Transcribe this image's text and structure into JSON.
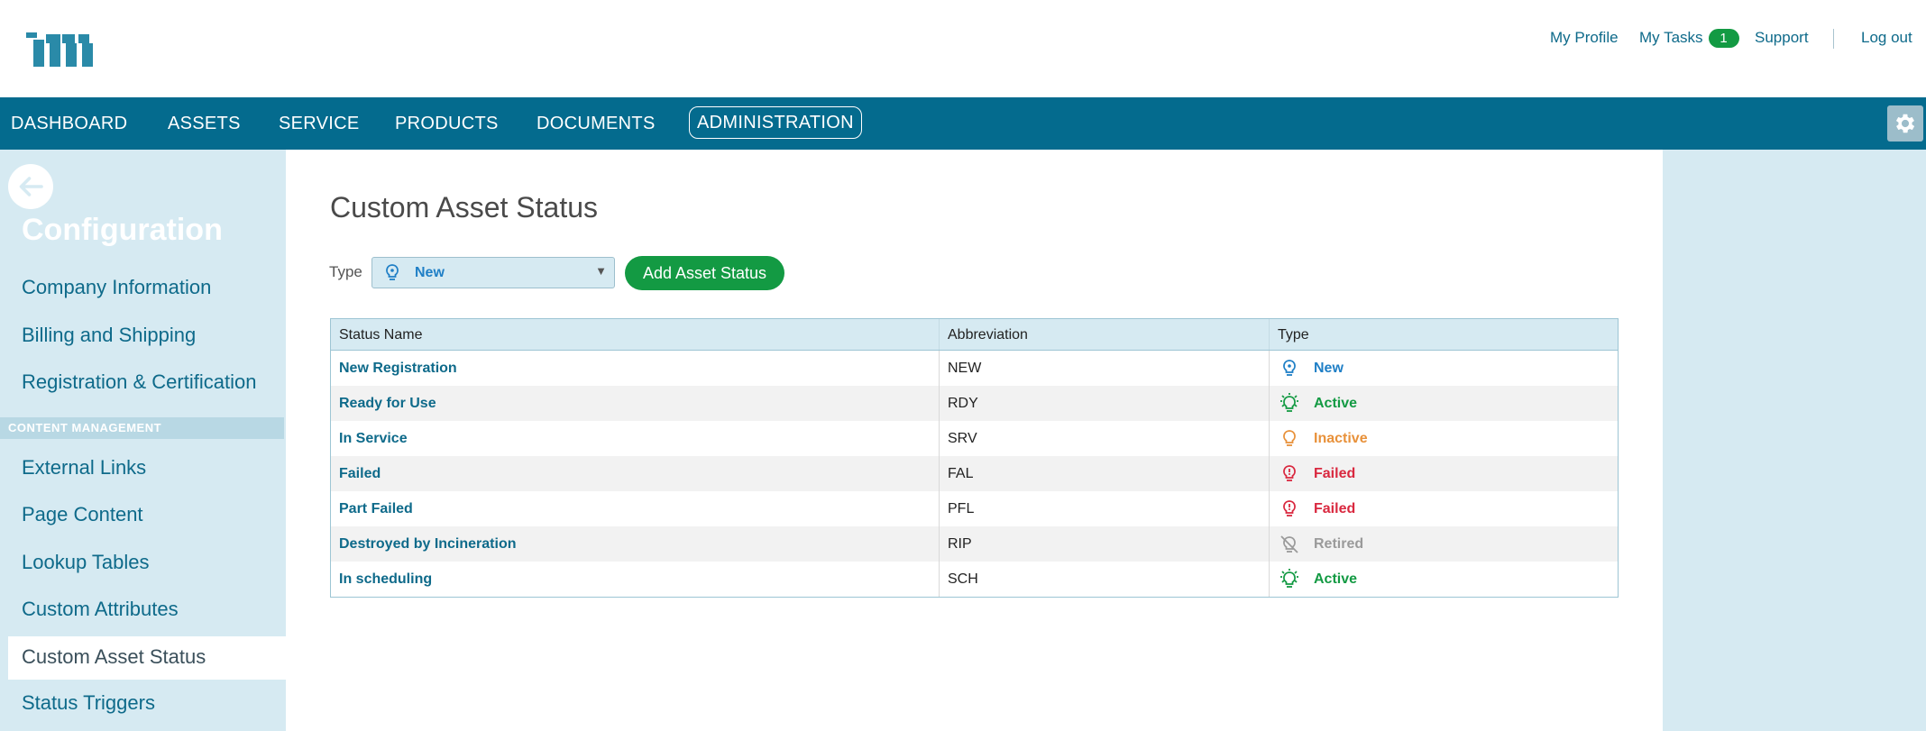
{
  "header": {
    "links": {
      "profile": "My Profile",
      "tasks": "My Tasks",
      "tasks_count": "1",
      "support": "Support",
      "logout": "Log out"
    }
  },
  "nav": {
    "items": [
      "DASHBOARD",
      "ASSETS",
      "SERVICE",
      "PRODUCTS",
      "DOCUMENTS",
      "ADMINISTRATION"
    ],
    "active": "ADMINISTRATION"
  },
  "sidebar": {
    "title": "Configuration",
    "items_top": [
      "Company Information",
      "Billing and Shipping",
      "Registration & Certification"
    ],
    "section": "CONTENT MANAGEMENT",
    "items_bottom": [
      "External Links",
      "Page Content",
      "Lookup Tables",
      "Custom Attributes"
    ],
    "active": "Custom Asset Status",
    "items_after": [
      "Status Triggers"
    ]
  },
  "main": {
    "title": "Custom Asset Status",
    "type_label": "Type",
    "type_value": "New",
    "add_button": "Add Asset Status",
    "table": {
      "headers": [
        "Status Name",
        "Abbreviation",
        "Type"
      ],
      "rows": [
        {
          "name": "New Registration",
          "abbr": "NEW",
          "type": "New"
        },
        {
          "name": "Ready for Use",
          "abbr": "RDY",
          "type": "Active"
        },
        {
          "name": "In Service",
          "abbr": "SRV",
          "type": "Inactive"
        },
        {
          "name": "Failed",
          "abbr": "FAL",
          "type": "Failed"
        },
        {
          "name": "Part Failed",
          "abbr": "PFL",
          "type": "Failed"
        },
        {
          "name": "Destroyed by Incineration",
          "abbr": "RIP",
          "type": "Retired"
        },
        {
          "name": "In scheduling",
          "abbr": "SCH",
          "type": "Active"
        }
      ]
    }
  },
  "colors": {
    "brand": "#046b8e",
    "sidebar_bg": "#d6eaf2",
    "primary_button": "#139a43",
    "type_new": "#1f7fc6",
    "type_active": "#139a43",
    "type_inactive": "#e8913a",
    "type_failed": "#d9283f",
    "type_retired": "#9a9a9a"
  }
}
